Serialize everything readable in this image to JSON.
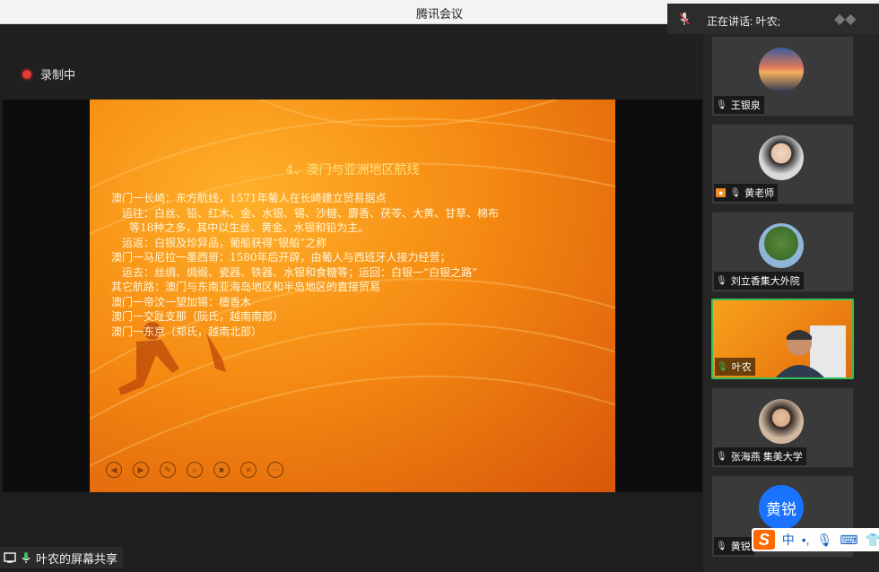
{
  "window": {
    "title": "腾讯会议"
  },
  "recording": {
    "label": "录制中"
  },
  "speaking": {
    "label": "正在讲话: 叶农;"
  },
  "slide": {
    "heading": "4、澳门与亚洲地区航线",
    "lines": [
      "澳门一长崎：东方航线，1571年葡人在长崎建立贸易据点",
      "  运往：白丝、铅、红木、金、水银、锡、沙糖、麝香、茯苓、大黄、甘草、棉布",
      "   等18种之多，其中以生丝、黄金、水银和铅为主。",
      "  运返：白银及珍异品，葡船获得“银船”之称",
      "澳门一马尼拉一墨西哥：1580年后开辟，由葡人与西班牙人接力经营；",
      "  运去：丝绸、绸缎、瓷器、铁器、水银和食糖等；运回：白银一“白银之路”",
      "其它航路：澳门与东南亚海岛地区和半岛地区的直接贸易",
      "澳门一帝汶一望加锡：檀香木",
      "澳门一交趾支那（阮氏，越南南部）",
      "澳门一东京（郑氏，越南北部）"
    ]
  },
  "participants": [
    {
      "name": "王银泉",
      "avatar": "sunset-photo",
      "mic": "muted"
    },
    {
      "name": "黄老师",
      "avatar": "portrait-photo",
      "mic": "muted",
      "host_badge": true
    },
    {
      "name": "刘立香集大外院",
      "avatar": "tree-photo",
      "mic": "muted"
    },
    {
      "name": "叶农",
      "avatar": "video-feed",
      "mic": "active"
    },
    {
      "name": "张海燕 集美大学",
      "avatar": "portrait-photo",
      "mic": "muted"
    },
    {
      "name": "黄锐",
      "avatar_text": "黄锐",
      "avatar_color": "#1a73ff",
      "mic": "muted"
    }
  ],
  "screen_share": {
    "label": "叶农的屏幕共享"
  },
  "ime": {
    "logo": "S",
    "mode": "中",
    "punct": "•,"
  },
  "colors": {
    "accent_green": "#36c05a",
    "record_red": "#e53935",
    "slide_orange": "#f58a12"
  }
}
